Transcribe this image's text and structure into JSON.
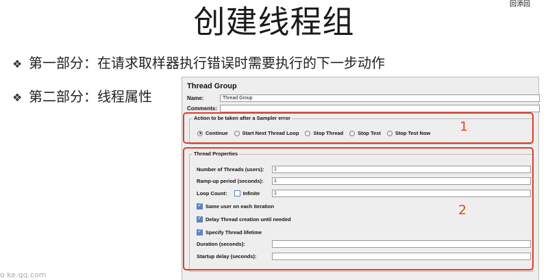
{
  "slide": {
    "title": "创建线程组",
    "bullet_mark": "❖",
    "bullets": [
      "第一部分：在请求取样器执行错误时需要执行的下一步动作",
      "第二部分：线程属性"
    ],
    "qr_text": "回添回",
    "watermark": "o ke.qq.com"
  },
  "panel": {
    "title": "Thread Group",
    "name_label": "Name:",
    "name_value": "Thread Group",
    "comments_label": "Comments:",
    "comments_value": "",
    "action": {
      "legend": "Action to be taken after a Sampler error",
      "options": [
        "Continue",
        "Start Next Thread Loop",
        "Stop Thread",
        "Stop Test",
        "Stop Test Now"
      ],
      "selected": "Continue"
    },
    "props": {
      "legend": "Thread Properties",
      "threads_label": "Number of Threads (users):",
      "threads_value": "1",
      "rampup_label": "Ramp-up period (seconds):",
      "rampup_value": "1",
      "loop_label": "Loop Count:",
      "infinite_label": "Infinite",
      "loop_value": "1",
      "same_user_label": "Same user on each iteration",
      "delay_label": "Delay Thread creation until needed",
      "lifetime_label": "Specify Thread lifetime",
      "duration_label": "Duration (seconds):",
      "duration_value": "",
      "startup_label": "Startup delay (seconds):",
      "startup_value": ""
    }
  },
  "annotations": {
    "box1": "1",
    "box2": "2",
    "color": "#e23b24"
  }
}
